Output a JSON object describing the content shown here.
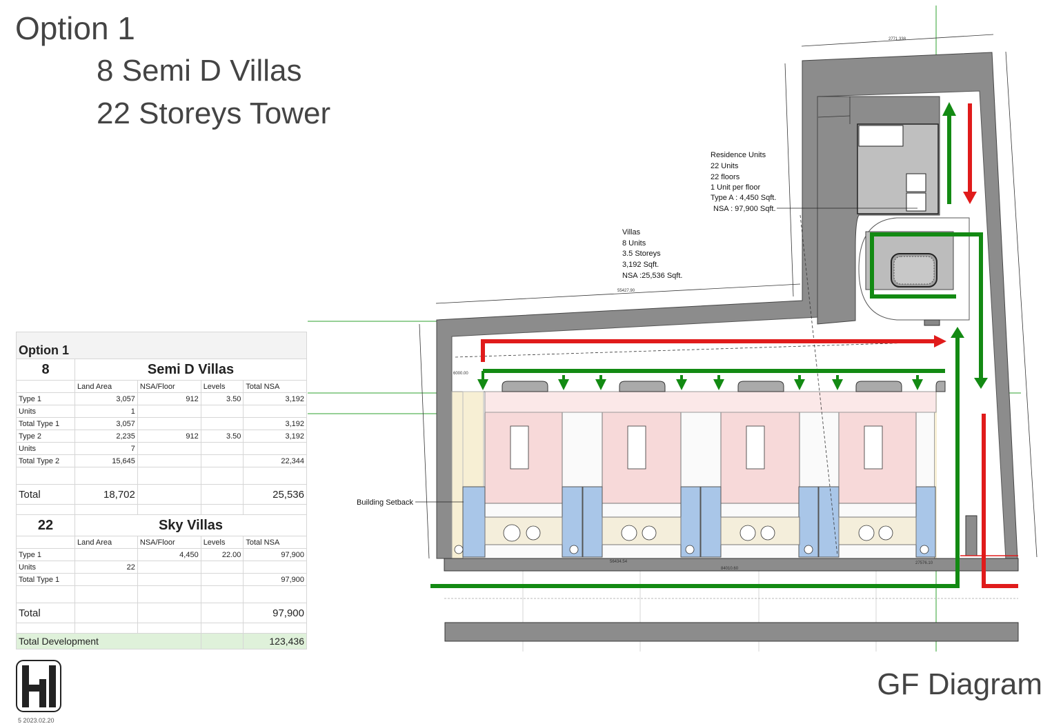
{
  "titles": {
    "option": "Option 1",
    "line2": "8 Semi D Villas",
    "line3": "22 Storeys Tower",
    "diagram": "GF Diagram"
  },
  "footer": {
    "page": "5  2023.02.20"
  },
  "schedule": {
    "option_label": "Option 1",
    "villas": {
      "count": "8",
      "title": "Semi D Villas",
      "headers": [
        "Land Area",
        "NSA/Floor",
        "Levels",
        "Total NSA"
      ],
      "rows": [
        {
          "label": "Type 1",
          "land": "3,057",
          "nsa": "912",
          "levels": "3.50",
          "total": "3,192"
        },
        {
          "label": "Units",
          "land": "1",
          "nsa": "",
          "levels": "",
          "total": ""
        },
        {
          "label": "Total Type 1",
          "land": "3,057",
          "nsa": "",
          "levels": "",
          "total": "3,192"
        },
        {
          "label": "Type 2",
          "land": "2,235",
          "nsa": "912",
          "levels": "3.50",
          "total": "3,192"
        },
        {
          "label": "Units",
          "land": "7",
          "nsa": "",
          "levels": "",
          "total": ""
        },
        {
          "label": "Total Type 2",
          "land": "15,645",
          "nsa": "",
          "levels": "",
          "total": "22,344"
        }
      ],
      "total": {
        "label": "Total",
        "land": "18,702",
        "total": "25,536"
      }
    },
    "sky": {
      "count": "22",
      "title": "Sky Villas",
      "headers": [
        "Land Area",
        "NSA/Floor",
        "Levels",
        "Total NSA"
      ],
      "rows": [
        {
          "label": "Type 1",
          "land": "",
          "nsa": "4,450",
          "levels": "22.00",
          "total": "97,900"
        },
        {
          "label": "Units",
          "land": "22",
          "nsa": "",
          "levels": "",
          "total": ""
        },
        {
          "label": "Total Type 1",
          "land": "",
          "nsa": "",
          "levels": "",
          "total": "97,900"
        }
      ],
      "total": {
        "label": "Total",
        "total": "97,900"
      }
    },
    "development": {
      "label": "Total Development",
      "value": "123,436"
    }
  },
  "annotations": {
    "residence": [
      "Residence Units",
      "22 Units",
      "22 floors",
      "1 Unit per floor",
      "Type A : 4,450 Sqft.",
      "NSA : 97,900 Sqft."
    ],
    "villas": [
      "Villas",
      "8 Units",
      "3.5 Storeys",
      "3,192 Sqft.",
      "NSA :25,536 Sqft."
    ],
    "setback": "Building Setback"
  },
  "dimensions": {
    "top": "2771.338",
    "side": "55427.90",
    "bottom1": "56434.54",
    "bottom2": "84010.60",
    "bottom3": "27576.10",
    "left": "6000.00"
  },
  "colors": {
    "road": "#8c8c8c",
    "villa": "#f7d9d9",
    "parking": "#a9c6e8",
    "setback": "#f7efd4",
    "green": "#138a13",
    "red": "#e01b1b"
  },
  "icons": {
    "logo": "hl-logo-icon"
  }
}
